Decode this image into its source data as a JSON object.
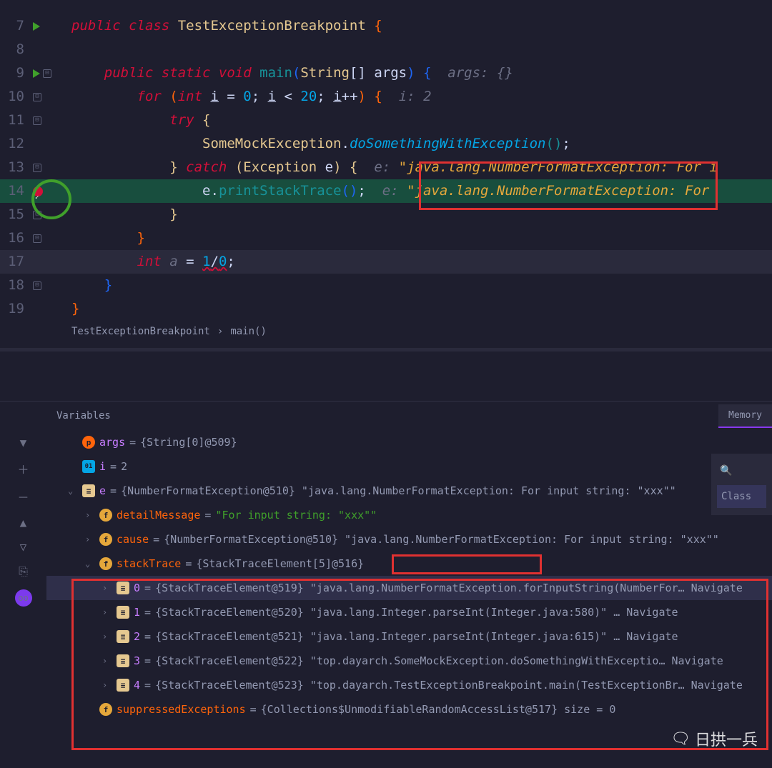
{
  "editor": {
    "lines": [
      {
        "n": 7,
        "indent": 0,
        "tokens": [
          {
            "t": "public ",
            "c": "kw-red"
          },
          {
            "t": "class ",
            "c": "kw-red"
          },
          {
            "t": "TestExceptionBreakpoint ",
            "c": "kw-yellow"
          },
          {
            "t": "{",
            "c": "kw-orange"
          }
        ],
        "run": true
      },
      {
        "n": 8,
        "indent": 0,
        "tokens": []
      },
      {
        "n": 9,
        "indent": 1,
        "tokens": [
          {
            "t": "public ",
            "c": "kw-red"
          },
          {
            "t": "static ",
            "c": "kw-red"
          },
          {
            "t": "void ",
            "c": "kw-red"
          },
          {
            "t": "main",
            "c": "kw-teal"
          },
          {
            "t": "(",
            "c": "kw-blue"
          },
          {
            "t": "String",
            "c": "kw-yellow"
          },
          {
            "t": "[] ",
            "c": "kw-white"
          },
          {
            "t": "args",
            "c": "kw-white"
          },
          {
            "t": ") ",
            "c": "kw-blue"
          },
          {
            "t": "{  ",
            "c": "kw-blue"
          },
          {
            "t": "args: {}",
            "c": "kw-gray"
          }
        ],
        "run": true,
        "fold": true
      },
      {
        "n": 10,
        "indent": 2,
        "tokens": [
          {
            "t": "for ",
            "c": "kw-red"
          },
          {
            "t": "(",
            "c": "kw-orange"
          },
          {
            "t": "int ",
            "c": "kw-red"
          },
          {
            "t": "i",
            "c": "kw-white",
            "u": true
          },
          {
            "t": " = ",
            "c": "kw-white"
          },
          {
            "t": "0",
            "c": "kw-num"
          },
          {
            "t": "; ",
            "c": "kw-white"
          },
          {
            "t": "i",
            "c": "kw-white",
            "u": true
          },
          {
            "t": " < ",
            "c": "kw-white"
          },
          {
            "t": "20",
            "c": "kw-num"
          },
          {
            "t": "; ",
            "c": "kw-white"
          },
          {
            "t": "i",
            "c": "kw-white",
            "u": true
          },
          {
            "t": "++",
            "c": "kw-white"
          },
          {
            "t": ") ",
            "c": "kw-orange"
          },
          {
            "t": "{  ",
            "c": "kw-orange"
          },
          {
            "t": "i: 2",
            "c": "kw-gray"
          }
        ],
        "fold": true
      },
      {
        "n": 11,
        "indent": 3,
        "tokens": [
          {
            "t": "try ",
            "c": "kw-red"
          },
          {
            "t": "{",
            "c": "kw-yellow"
          }
        ],
        "fold": true
      },
      {
        "n": 12,
        "indent": 4,
        "tokens": [
          {
            "t": "SomeMockException",
            "c": "kw-yellow"
          },
          {
            "t": ".",
            "c": "kw-white"
          },
          {
            "t": "doSomethingWithException",
            "c": "kw-cyan"
          },
          {
            "t": "()",
            "c": "kw-teal"
          },
          {
            "t": ";",
            "c": "kw-white"
          }
        ]
      },
      {
        "n": 13,
        "indent": 3,
        "tokens": [
          {
            "t": "} ",
            "c": "kw-yellow"
          },
          {
            "t": "catch ",
            "c": "kw-red"
          },
          {
            "t": "(",
            "c": "kw-yellow"
          },
          {
            "t": "Exception ",
            "c": "kw-yellow"
          },
          {
            "t": "e",
            "c": "kw-white"
          },
          {
            "t": ") ",
            "c": "kw-yellow"
          },
          {
            "t": "{  ",
            "c": "kw-yellow"
          },
          {
            "t": "e: ",
            "c": "kw-gray"
          },
          {
            "t": "\"java.lang.NumberFormatException:",
            "c": "kw-hint"
          },
          {
            "t": " For i",
            "c": "kw-hint"
          }
        ],
        "fold": true
      },
      {
        "n": 14,
        "indent": 4,
        "exec": true,
        "bp": true,
        "tokens": [
          {
            "t": "e",
            "c": "kw-white"
          },
          {
            "t": ".",
            "c": "kw-white"
          },
          {
            "t": "printStackTrace",
            "c": "kw-teal"
          },
          {
            "t": "()",
            "c": "kw-blue"
          },
          {
            "t": ";  ",
            "c": "kw-white"
          },
          {
            "t": "e: ",
            "c": "kw-gray"
          },
          {
            "t": "\"java.lang.NumberFormatException:",
            "c": "kw-hint"
          },
          {
            "t": " For ",
            "c": "kw-hint"
          }
        ]
      },
      {
        "n": 15,
        "indent": 3,
        "tokens": [
          {
            "t": "}",
            "c": "kw-yellow"
          }
        ],
        "foldend": true
      },
      {
        "n": 16,
        "indent": 2,
        "tokens": [
          {
            "t": "}",
            "c": "kw-orange"
          }
        ],
        "foldend": true
      },
      {
        "n": 17,
        "indent": 2,
        "hl": true,
        "tokens": [
          {
            "t": "int ",
            "c": "kw-red"
          },
          {
            "t": "a",
            "c": "kw-gray"
          },
          {
            "t": " = ",
            "c": "kw-white"
          },
          {
            "t": "1",
            "c": "kw-num",
            "err": true
          },
          {
            "t": "/",
            "c": "kw-white",
            "err": true
          },
          {
            "t": "0",
            "c": "kw-num",
            "err": true
          },
          {
            "t": ";",
            "c": "kw-white"
          }
        ]
      },
      {
        "n": 18,
        "indent": 1,
        "tokens": [
          {
            "t": "}",
            "c": "kw-blue"
          }
        ],
        "foldend": true
      },
      {
        "n": 19,
        "indent": 0,
        "tokens": [
          {
            "t": "}",
            "c": "kw-orange"
          }
        ]
      }
    ]
  },
  "breadcrumb": {
    "class": "TestExceptionBreakpoint",
    "method": "main()"
  },
  "debug": {
    "header": "Variables",
    "memory_tab": "Memory",
    "side": {
      "search": "🔍",
      "class": "Class"
    },
    "vars": [
      {
        "depth": 0,
        "chev": "",
        "icon": "p",
        "name": "args",
        "eq": " = ",
        "val": "{String[0]@509}",
        "ncls": "vname"
      },
      {
        "depth": 0,
        "chev": "",
        "icon": "oi",
        "name": "i",
        "eq": " = ",
        "val": "2",
        "ncls": "vname"
      },
      {
        "depth": 0,
        "chev": "v",
        "icon": "obj",
        "name": "e",
        "eq": " = ",
        "val": "{NumberFormatException@510} \"java.lang.NumberFormatException: For input string: \"xxx\"\"",
        "ncls": "vname"
      },
      {
        "depth": 1,
        "chev": ">",
        "icon": "f",
        "name": "detailMessage",
        "eq": " = ",
        "val": "\"For input string: \"xxx\"\"",
        "ncls": "vname-o",
        "vcls": "vstr"
      },
      {
        "depth": 1,
        "chev": ">",
        "icon": "f",
        "name": "cause",
        "eq": " = ",
        "val": "{NumberFormatException@510} \"java.lang.NumberFormatException: For input string: \"xxx\"\"",
        "ncls": "vname-o"
      },
      {
        "depth": 1,
        "chev": "v",
        "icon": "f",
        "name": "stackTrace",
        "eq": " = ",
        "val": "{StackTraceElement[5]@516}",
        "ncls": "vname-o"
      },
      {
        "depth": 2,
        "chev": ">",
        "icon": "arr",
        "name": "0",
        "eq": " = ",
        "val": "{StackTraceElement@519} \"java.lang.NumberFormatException.forInputString(NumberFor… Navigate",
        "ncls": "vname",
        "sel": true
      },
      {
        "depth": 2,
        "chev": ">",
        "icon": "arr",
        "name": "1",
        "eq": " = ",
        "val": "{StackTraceElement@520} \"java.lang.Integer.parseInt(Integer.java:580)\" … Navigate",
        "ncls": "vname"
      },
      {
        "depth": 2,
        "chev": ">",
        "icon": "arr",
        "name": "2",
        "eq": " = ",
        "val": "{StackTraceElement@521} \"java.lang.Integer.parseInt(Integer.java:615)\" … Navigate",
        "ncls": "vname"
      },
      {
        "depth": 2,
        "chev": ">",
        "icon": "arr",
        "name": "3",
        "eq": " = ",
        "val": "{StackTraceElement@522} \"top.dayarch.SomeMockException.doSomethingWithExceptio… Navigate",
        "ncls": "vname"
      },
      {
        "depth": 2,
        "chev": ">",
        "icon": "arr",
        "name": "4",
        "eq": " = ",
        "val": "{StackTraceElement@523} \"top.dayarch.TestExceptionBreakpoint.main(TestExceptionBr… Navigate",
        "ncls": "vname"
      },
      {
        "depth": 1,
        "chev": "",
        "icon": "f",
        "name": "suppressedExceptions",
        "eq": " = ",
        "val": "{Collections$UnmodifiableRandomAccessList@517}  size = 0",
        "ncls": "vname-o"
      }
    ]
  },
  "watermark": "日拱一兵"
}
